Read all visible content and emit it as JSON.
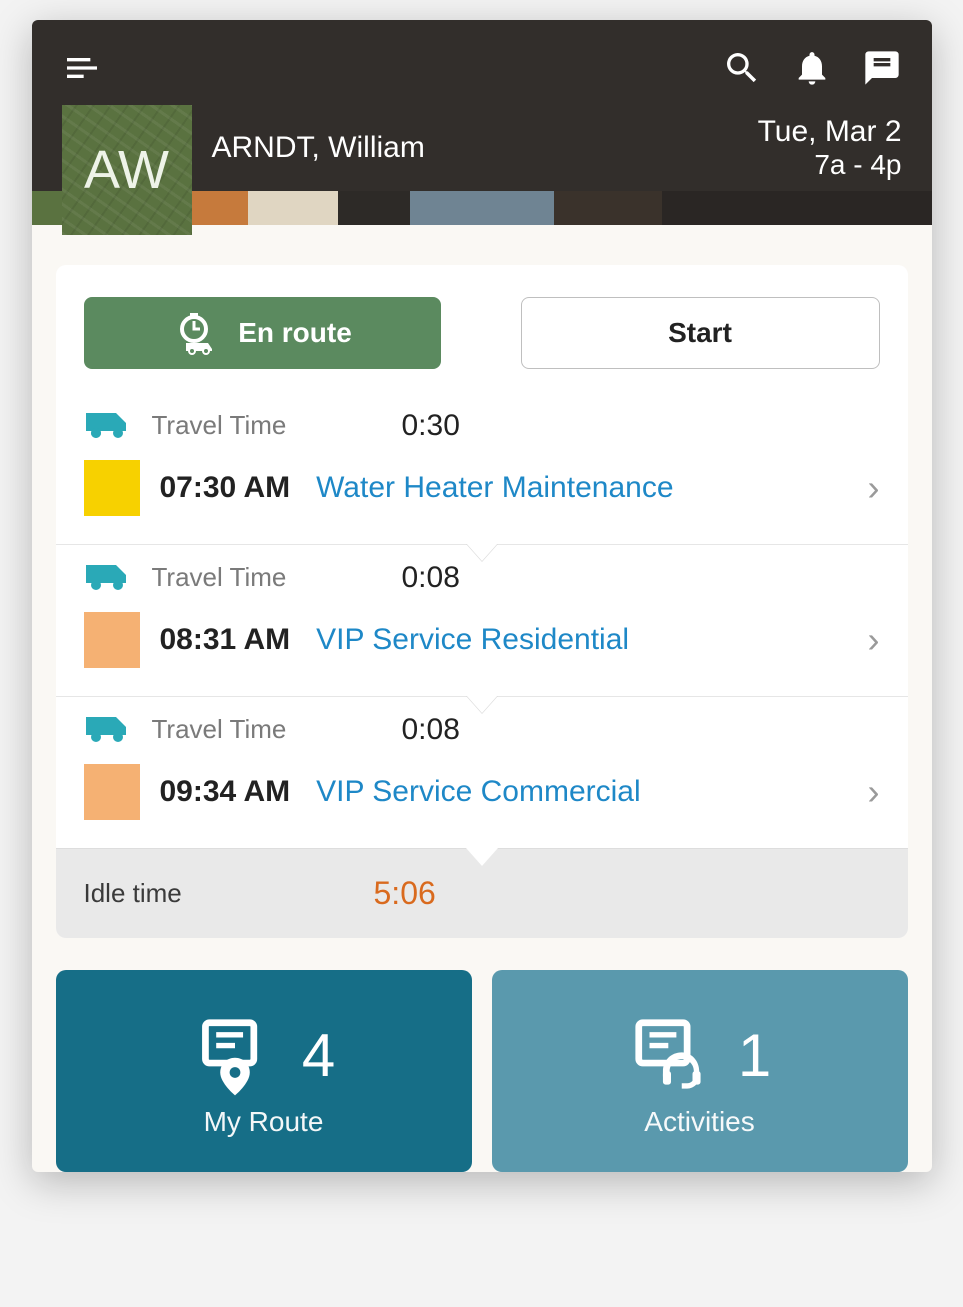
{
  "header": {
    "avatar_initials": "AW",
    "name": "ARNDT, William",
    "date": "Tue, Mar 2",
    "hours": "7a - 4p"
  },
  "actions": {
    "primary_label": "En route",
    "secondary_label": "Start"
  },
  "route": [
    {
      "travel_label": "Travel Time",
      "travel_value": "0:30",
      "color": "#f7d100",
      "time": "07:30 AM",
      "title": "Water Heater Maintenance"
    },
    {
      "travel_label": "Travel Time",
      "travel_value": "0:08",
      "color": "#f5b173",
      "time": "08:31 AM",
      "title": "VIP Service Residential"
    },
    {
      "travel_label": "Travel Time",
      "travel_value": "0:08",
      "color": "#f5b173",
      "time": "09:34 AM",
      "title": "VIP Service Commercial"
    }
  ],
  "idle": {
    "label": "Idle time",
    "value": "5:06"
  },
  "tiles": {
    "route": {
      "count": "4",
      "label": "My Route"
    },
    "activities": {
      "count": "1",
      "label": "Activities"
    }
  }
}
